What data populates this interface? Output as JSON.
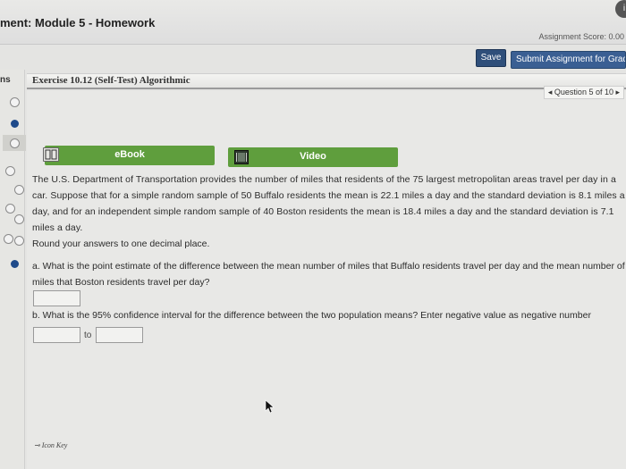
{
  "header": {
    "title": "ment: Module 5 - Homework",
    "score": "Assignment Score: 0.00",
    "circle_glyph": "i"
  },
  "toolbar": {
    "save_label": "Save",
    "submit_label": "Submit Assignment for Grading"
  },
  "sidebar": {
    "tab_label": "ns",
    "dots": [
      "empty",
      "filled",
      "empty",
      "empty",
      "empty",
      "empty",
      "empty",
      "filled"
    ]
  },
  "exercise": {
    "title": "Exercise 10.12 (Self-Test) Algorithmic",
    "question_nav": "◂ Question 5 of 10 ▸"
  },
  "resources": {
    "ebook_label": "eBook",
    "video_label": "Video"
  },
  "problem": {
    "text": "The U.S. Department of Transportation provides the number of miles that residents of the 75 largest metropolitan areas travel per day in a car. Suppose that for a simple random sample of 50 Buffalo residents the mean is 22.1 miles a day and the standard deviation is 8.1 miles a day, and for an independent simple random sample of 40 Boston residents the mean is 18.4 miles a day and the standard deviation is 7.1 miles a day.",
    "instruction": "Round your answers to one decimal place."
  },
  "questions": {
    "a": "a. What is the point estimate of the difference between the mean number of miles that Buffalo residents travel per day and the mean number of miles that Boston residents travel per day?",
    "b": "b. What is the 95% confidence interval for the difference between the two population means? Enter negative value as negative number",
    "answer_a": "",
    "ci_low": "",
    "ci_to": "to",
    "ci_high": ""
  },
  "footer": {
    "icon_key": "Icon Key"
  },
  "colors": {
    "accent_blue": "#2f4f7a",
    "green_button": "#5f9e3d",
    "nav_dot_filled": "#1e4a8a"
  }
}
